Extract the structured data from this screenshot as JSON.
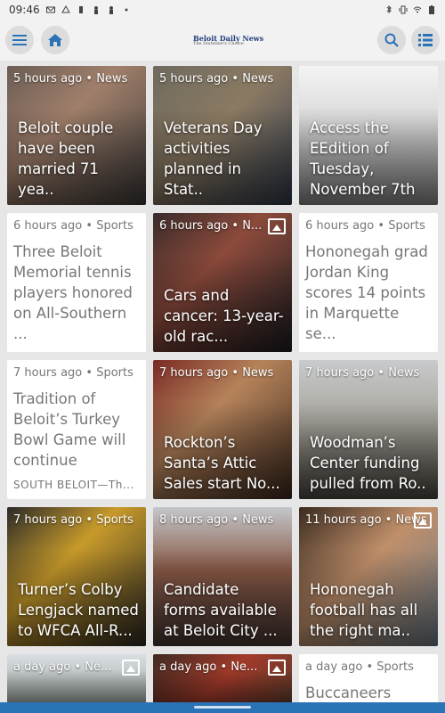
{
  "status": {
    "time": "09:46",
    "left_icons": [
      "mail-icon",
      "drive-icon",
      "usb-icon",
      "person-icon",
      "person-icon",
      "dot-icon"
    ],
    "right_icons": [
      "bluetooth-icon",
      "vibrate-icon",
      "wifi-icon",
      "battery-icon"
    ]
  },
  "appbar": {
    "logo_title": "Beloit Daily News",
    "logo_sub": "The Stateline's Choice",
    "menu_icon": "hamburger-icon",
    "home_icon": "home-icon",
    "search_icon": "search-icon",
    "list_icon": "list-icon"
  },
  "colors": {
    "background": "#e6e6e6",
    "card_text_bg": "#ffffff",
    "button_bg": "#dcdcdc",
    "icon_blue": "#2b73b7"
  },
  "articles": [
    {
      "meta": "5 hours ago • News",
      "headline": "Beloit couple have been married 71 yea..",
      "type": "img",
      "gallery": false,
      "bg": "linear-gradient(135deg,#6b5d54 0%,#a07f6b 40%,#3d3a39 100%)"
    },
    {
      "meta": "5 hours ago • News",
      "headline": "Veterans Day activities planned in Stat..",
      "type": "img",
      "gallery": false,
      "bg": "linear-gradient(135deg,#6e6a5e 0%,#8b7a63 45%,#2f3a4a 100%)"
    },
    {
      "meta": "",
      "headline": "Access the EEdition of Tuesday, November 7th",
      "type": "img",
      "gallery": false,
      "bg": "linear-gradient(180deg,#f4f4f4 0%,#d9d9d9 40%,#8a8a8a 100%)"
    },
    {
      "meta": "6 hours ago • Sports",
      "headline": "Three Beloit Memorial tennis players honored on All-Southern ...",
      "type": "text",
      "gallery": false,
      "excerpt": ""
    },
    {
      "meta": "6 hours ago • N...",
      "headline": "Cars and cancer: 13-year-old rac...",
      "type": "img",
      "gallery": true,
      "bg": "linear-gradient(135deg,#3a2b2a 0%,#8c4a3b 40%,#1e1e22 100%)"
    },
    {
      "meta": "6 hours ago • Sports",
      "headline": "Hononegah grad Jordan King scores 14 points in Marquette se...",
      "type": "text",
      "gallery": false,
      "excerpt": ""
    },
    {
      "meta": "7 hours ago • Sports",
      "headline": "Tradition of Beloit’s Turkey Bowl Game will continue",
      "type": "text",
      "gallery": false,
      "excerpt": "SOUTH BELOIT—Th..."
    },
    {
      "meta": "7 hours ago • News",
      "headline": "Rockton’s Santa’s Attic Sales start No...",
      "type": "img",
      "gallery": false,
      "bg": "linear-gradient(135deg,#7a2a25 0%,#b5835a 40%,#3f2a1f 100%)"
    },
    {
      "meta": "7 hours ago • News",
      "headline": "Woodman’s Center funding pulled from Ro..",
      "type": "img",
      "gallery": false,
      "bg": "linear-gradient(180deg,#c8cbcc 0%,#a7a49c 45%,#4f4a43 100%)"
    },
    {
      "meta": "7 hours ago • Sports",
      "headline": "Turner’s Colby Lengjack named to WFCA All-R...",
      "type": "img",
      "gallery": false,
      "bg": "linear-gradient(135deg,#2b2a28 0%,#c79a2a 40%,#2d2a24 100%)"
    },
    {
      "meta": "8 hours ago • News",
      "headline": "Candidate forms available at Beloit City ...",
      "type": "img",
      "gallery": false,
      "bg": "linear-gradient(180deg,#c3c7cb 0%,#8a5a47 45%,#4a3a35 100%)"
    },
    {
      "meta": "11 hours ago • News",
      "headline": "Hononegah football has all the right ma..",
      "type": "img",
      "gallery": true,
      "bg": "linear-gradient(135deg,#3a2b20 0%,#c08f6a 45%,#6b7c89 100%)"
    },
    {
      "meta": "a day ago • Ne...",
      "headline": "",
      "type": "img",
      "gallery": true,
      "partial": true,
      "bg": "linear-gradient(180deg,#d9dee2 0%,#9aa39c 100%)"
    },
    {
      "meta": "a day ago • Ne...",
      "headline": "",
      "type": "img",
      "gallery": true,
      "partial": true,
      "bg": "linear-gradient(135deg,#3d2a22 0%,#a33a2a 50%,#5a3b2a 100%)"
    },
    {
      "meta": "a day ago • Sports",
      "headline": "Buccaneers",
      "type": "text",
      "gallery": false,
      "partial": true,
      "excerpt": ""
    }
  ]
}
